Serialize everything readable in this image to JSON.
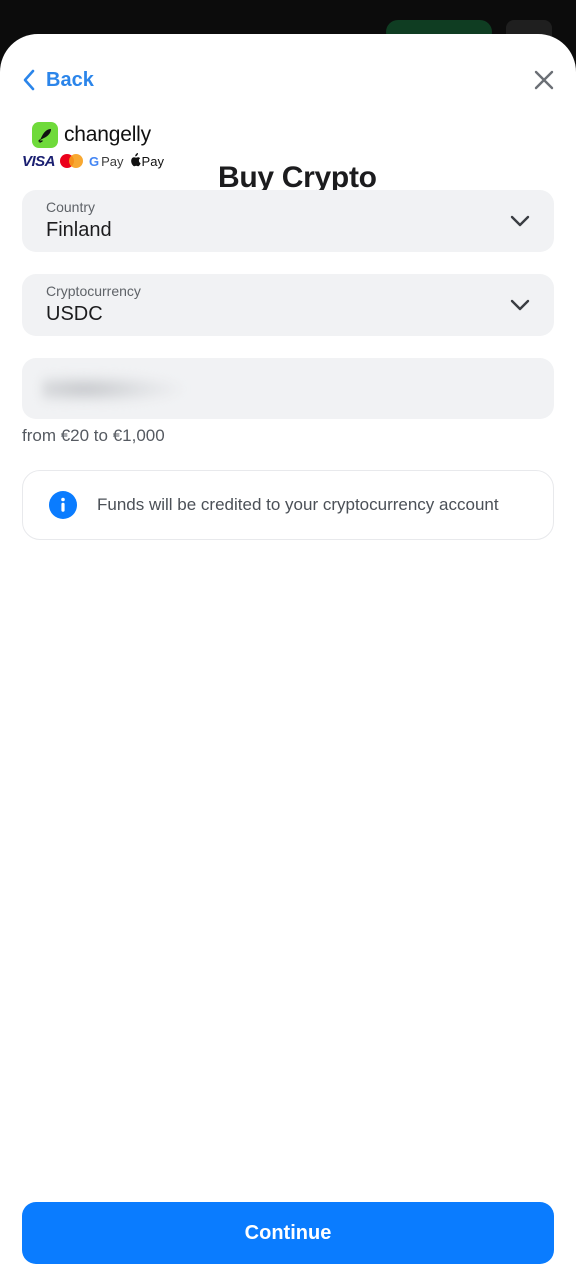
{
  "header": {
    "back_label": "Back",
    "title": "Buy Crypto"
  },
  "brand": {
    "name": "changelly",
    "payments": {
      "visa": "VISA",
      "google_pay": "Pay",
      "google_pay_g": "G",
      "apple_pay": "Pay"
    }
  },
  "form": {
    "country": {
      "label": "Country",
      "value": "Finland"
    },
    "cryptocurrency": {
      "label": "Cryptocurrency",
      "value": "USDC"
    },
    "amount": {
      "value": ""
    },
    "range_text": "from €20 to €1,000"
  },
  "info": {
    "text": "Funds will be credited to your cryptocurrency account"
  },
  "actions": {
    "continue_label": "Continue"
  },
  "colors": {
    "accent": "#0a7cff",
    "link": "#2b85ea",
    "brand_green": "#6fda3a",
    "field_bg": "#f1f2f4"
  },
  "icons": {
    "back": "chevron-left-icon",
    "close": "close-icon",
    "dropdown": "chevron-down-icon",
    "info": "info-icon",
    "brand": "rocket-icon"
  }
}
